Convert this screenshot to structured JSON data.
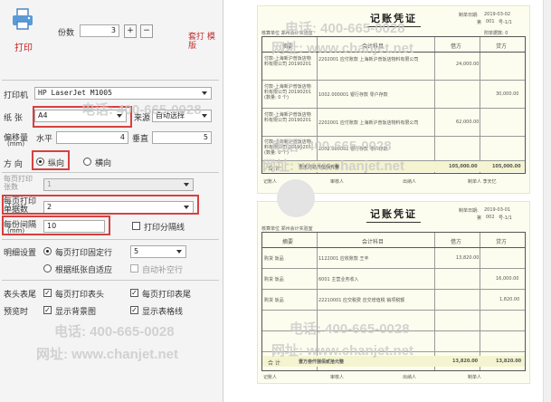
{
  "print_btn": {
    "label": "打印",
    "icon": "printer-icon"
  },
  "copies": {
    "label": "份数",
    "value": "3",
    "plus": "+",
    "minus": "−"
  },
  "link_label": "套打 模版",
  "printer": {
    "label": "打印机",
    "value": "HP LaserJet M1005"
  },
  "paper": {
    "label": "纸  张",
    "value": "A4",
    "source_label": "来源",
    "source_value": "自动选择"
  },
  "offset": {
    "label": "偏移量",
    "unit": "(mm)",
    "h_label": "水平",
    "h_value": "4",
    "v_label": "垂直",
    "v_value": "5"
  },
  "orientation": {
    "label": "方  向",
    "portrait": "纵向",
    "landscape": "横向"
  },
  "vouchers_per_page": {
    "label": "每页打印张数",
    "value": "1"
  },
  "per_sheet": {
    "label": "每页打印单据数",
    "value": "2"
  },
  "spacing": {
    "label": "每份间隔",
    "unit": "(mm)",
    "value": "10",
    "sep_line": "打印分隔线"
  },
  "detail": {
    "label": "明细设置",
    "fixed_rows": "每页打印固定行",
    "rows_value": "5",
    "adaptive": "根据纸张自适应",
    "auto_fill": "自动补空行"
  },
  "header_footer": {
    "label": "表头表尾",
    "print_header": "每页打印表头",
    "print_footer": "每页打印表尾"
  },
  "preview": {
    "label": "预览时",
    "show_bg": "显示背景图",
    "show_grid": "显示表格线"
  },
  "watermark": {
    "phone": "电话: 400-665-0028",
    "site": "网址: www.chanjet.net"
  },
  "voucher1": {
    "title": "记账凭证",
    "date_label": "制单日期:",
    "date": "2019-03-02",
    "no_label": "第",
    "no": "001",
    "page": "号-1/1",
    "unit": "核算单位 郑州会计实验室",
    "attach": "附单据数: 0",
    "headers": [
      "摘要",
      "会计科目",
      "借方",
      "贷方"
    ],
    "rows": [
      {
        "summary": "付款-上海新沪普饭店物料有限公司 20190201",
        "account": "2202001 应付账款 上海新沪普饭店物料有限公司",
        "debit": "24,000.00",
        "credit": ""
      },
      {
        "summary": "付款-上海新沪普饭店物料有限公司 20190201 (数量: 0 个)",
        "account": "1002.000001 银行存款 零户存款",
        "debit": "",
        "credit": "30,000.00"
      },
      {
        "summary": "付款-上海新沪普饭店物料有限公司 20190201",
        "account": "2202001 应付账款 上海新沪普饭店物料有限公司",
        "debit": "62,000.00",
        "credit": ""
      },
      {
        "summary": "付款-上海新沪普饭店物料有限公司 20190201 (数量: 0 个)",
        "account": "1002.000001 银行存款 零户存款",
        "debit": "",
        "credit": ""
      }
    ],
    "total_label": "合 计",
    "total_text": "壹拾万玖仟伍佰元整",
    "total_debit": "105,000.00",
    "total_credit": "105,000.00",
    "footer": [
      "记账人",
      "审核人",
      "出纳人",
      "制单人 李天忆"
    ]
  },
  "voucher2": {
    "title": "记账凭证",
    "date_label": "制单日期:",
    "date": "2019-03-01",
    "no_label": "第",
    "no": "002",
    "page": "号-1/1",
    "unit": "核算单位 郑州会计实验室",
    "headers": [
      "摘要",
      "会计科目",
      "借方",
      "贷方"
    ],
    "rows": [
      {
        "summary": "购货 饭品",
        "account": "1122001 应收账款 王丰",
        "debit": "13,820.00",
        "credit": ""
      },
      {
        "summary": "购货 饭品",
        "account": "6001 主营业务收入",
        "debit": "",
        "credit": "16,000.00"
      },
      {
        "summary": "购货 饭品",
        "account": "22210001 应交税费 应交增值税 销项税额",
        "debit": "",
        "credit": "1,820.00"
      },
      {
        "summary": "",
        "account": "",
        "debit": "",
        "credit": ""
      },
      {
        "summary": "",
        "account": "",
        "debit": "",
        "credit": ""
      }
    ],
    "total_label": "合 计",
    "total_text": "壹万叁仟捌佰贰拾元整",
    "total_debit": "13,820.00",
    "total_credit": "13,820.00",
    "footer": [
      "记账人",
      "审核人",
      "出纳人",
      "制单人"
    ]
  }
}
